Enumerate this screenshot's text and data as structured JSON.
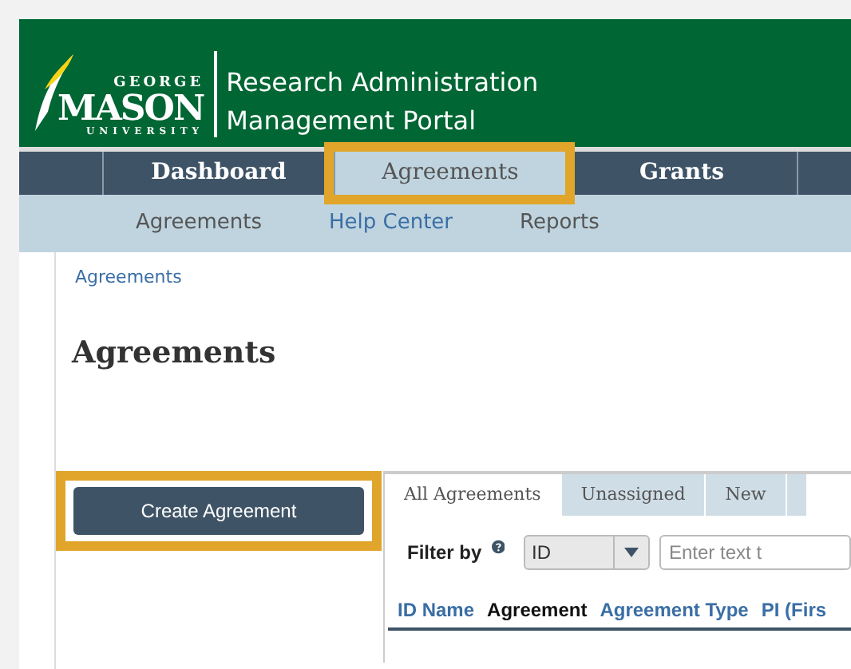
{
  "header": {
    "logo": {
      "top": "GEORGE",
      "main": "MASON",
      "bottom": "UNIVERSITY"
    },
    "title_lines": [
      "Research Administration",
      "Management Portal"
    ]
  },
  "nav": [
    {
      "label": "Dashboard",
      "selected": false,
      "highlighted": false
    },
    {
      "label": "Agreements",
      "selected": true,
      "highlighted": true
    },
    {
      "label": "Grants",
      "selected": false,
      "highlighted": false
    }
  ],
  "subnav": [
    {
      "label": "Agreements",
      "kind": "plain"
    },
    {
      "label": "Help Center",
      "kind": "link"
    },
    {
      "label": "Reports",
      "kind": "plain"
    }
  ],
  "breadcrumb": "Agreements",
  "page_title": "Agreements",
  "create_button": {
    "label": "Create Agreement",
    "highlighted": true
  },
  "tabs": [
    {
      "label": "All Agreements",
      "selected": true
    },
    {
      "label": "Unassigned",
      "selected": false
    },
    {
      "label": "New",
      "selected": false
    }
  ],
  "filter": {
    "label": "Filter by",
    "select_value": "ID",
    "placeholder": "Enter text t"
  },
  "columns": [
    {
      "label": "ID Name",
      "sorted": false
    },
    {
      "label": "Agreement",
      "sorted": true
    },
    {
      "label": "Agreement Type",
      "sorted": false
    },
    {
      "label": "PI (Firs",
      "sorted": false
    }
  ]
}
